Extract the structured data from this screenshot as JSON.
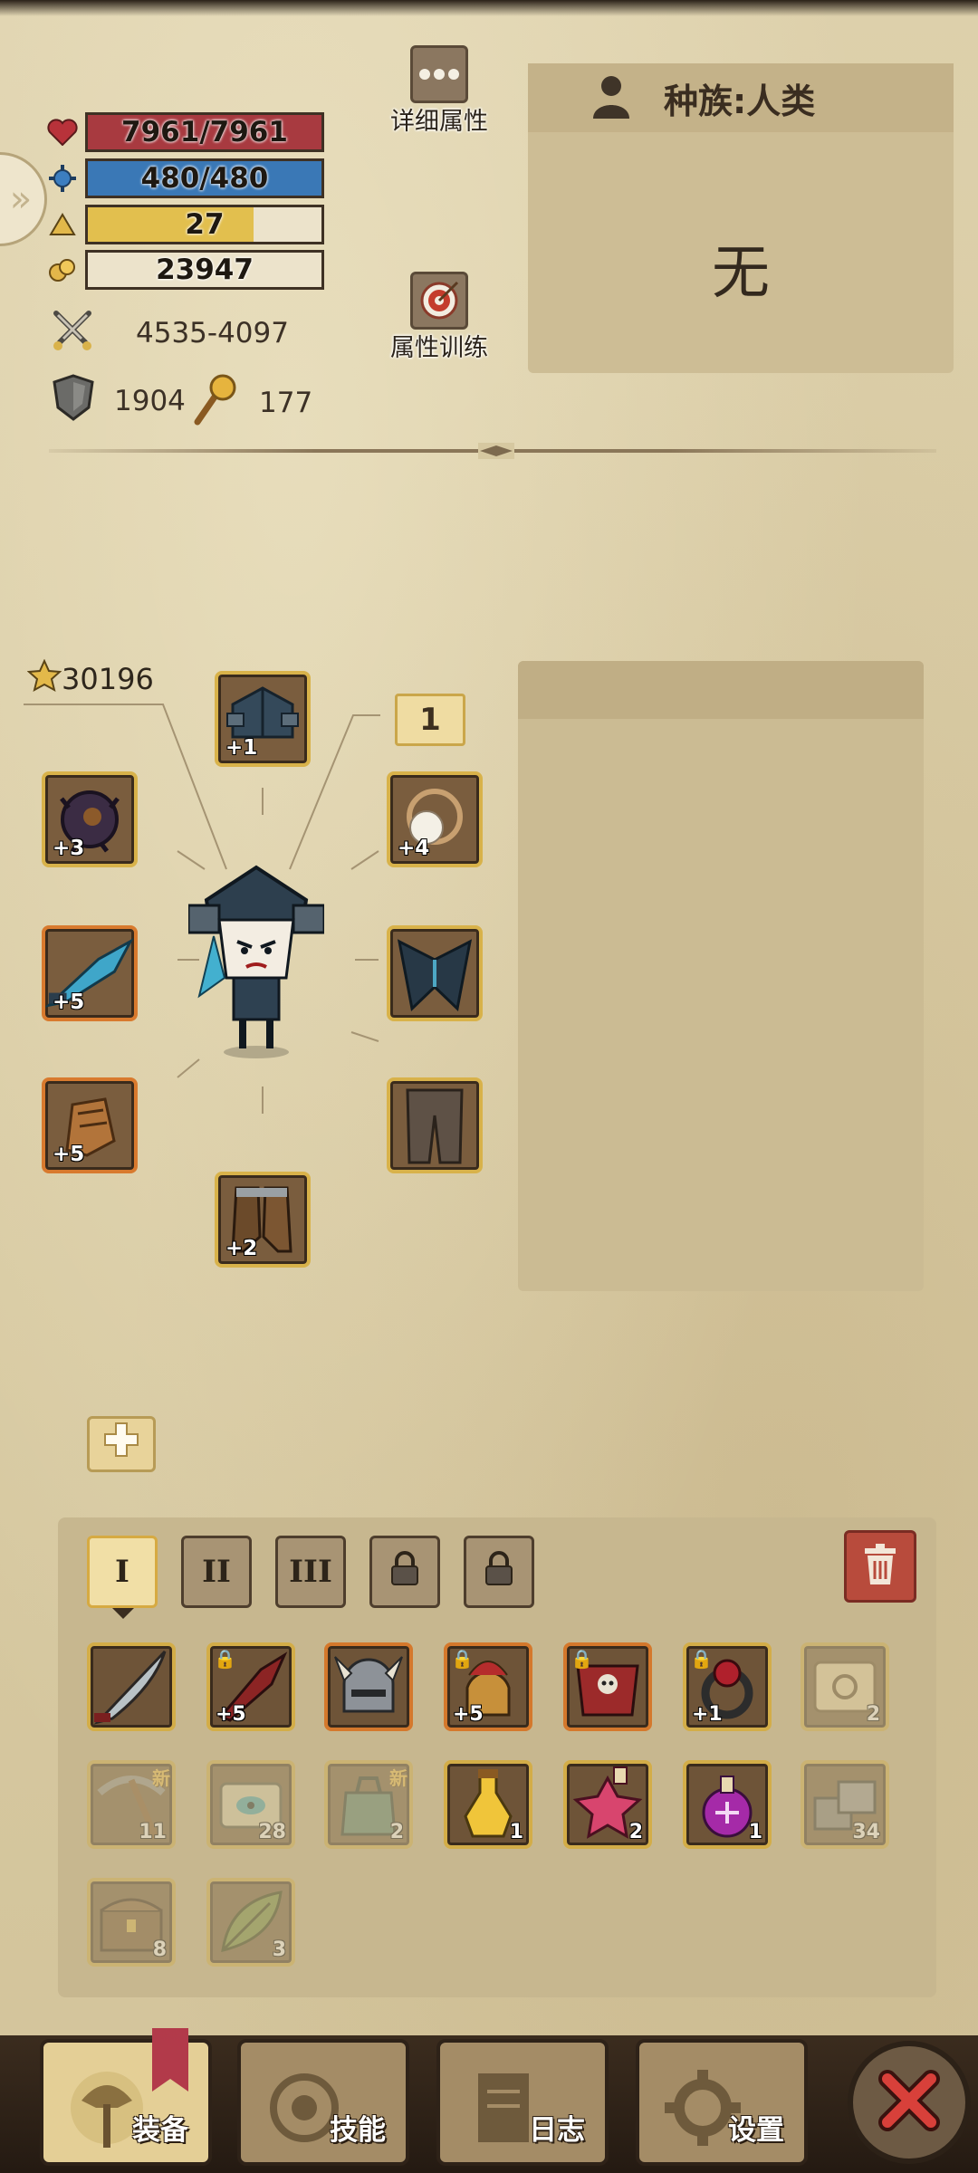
{
  "stats": {
    "hp": {
      "label": "7961/7961",
      "fraction": 1.0,
      "color": "#a83a40"
    },
    "mp": {
      "label": "480/480",
      "fraction": 1.0,
      "color": "#3a78b6"
    },
    "exp": {
      "label": "27",
      "fraction": 0.71,
      "color": "#e2bf4e"
    },
    "gold": {
      "label": "23947"
    },
    "attack": "4535-4097",
    "defense": "1904",
    "magic": "177"
  },
  "buttons": {
    "detail_attrs": "详细属性",
    "attr_training": "属性训练"
  },
  "race": {
    "title": "种族:人类",
    "value": "无"
  },
  "equipment": {
    "score": "30196",
    "level_badge": "1",
    "slots": {
      "helmet": "+1",
      "ring_left": "+3",
      "weapon": "+5",
      "gloves": "+5",
      "boots": "+2",
      "amulet": "+4"
    }
  },
  "inventory": {
    "tabs": [
      "I",
      "II",
      "III"
    ],
    "row1": [
      {
        "name": "curved-sword",
        "plus": ""
      },
      {
        "name": "red-blade",
        "plus": "+5"
      },
      {
        "name": "horned-helmet",
        "plus": ""
      },
      {
        "name": "spartan-helmet",
        "plus": "+5"
      },
      {
        "name": "skull-armor",
        "plus": ""
      },
      {
        "name": "ruby-ring",
        "plus": "+1"
      },
      {
        "name": "scroll-map",
        "count": "2"
      }
    ],
    "row2": [
      {
        "name": "pickaxe",
        "count": "11",
        "new": "新"
      },
      {
        "name": "eye-scroll",
        "count": "28"
      },
      {
        "name": "green-bag",
        "count": "2",
        "new": "新"
      },
      {
        "name": "yellow-potion",
        "count": "1"
      },
      {
        "name": "pink-potion",
        "count": "2"
      },
      {
        "name": "purple-potion",
        "count": "1"
      },
      {
        "name": "stone-block",
        "count": "34"
      }
    ],
    "row3": [
      {
        "name": "chest",
        "count": "8"
      },
      {
        "name": "leaf-herb",
        "count": "3"
      }
    ]
  },
  "nav": {
    "equip": "装备",
    "skills": "技能",
    "log": "日志",
    "settings": "设置"
  }
}
